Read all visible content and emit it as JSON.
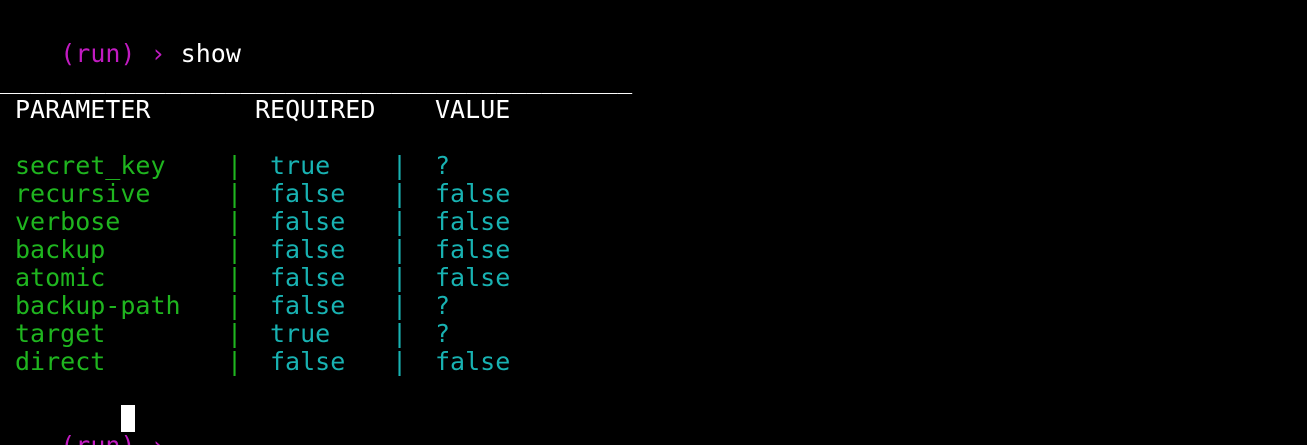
{
  "prompt": {
    "context": "(run)",
    "arrow": "›"
  },
  "command": "show",
  "separator": "__________________________________________",
  "table": {
    "headers": [
      "PARAMETER",
      "REQUIRED",
      "VALUE"
    ],
    "delimiter": "|",
    "rows": [
      {
        "parameter": "secret_key",
        "required": "true",
        "value": "?"
      },
      {
        "parameter": "recursive",
        "required": "false",
        "value": "false"
      },
      {
        "parameter": "verbose",
        "required": "false",
        "value": "false"
      },
      {
        "parameter": "backup",
        "required": "false",
        "value": "false"
      },
      {
        "parameter": "atomic",
        "required": "false",
        "value": "false"
      },
      {
        "parameter": "backup-path",
        "required": "false",
        "value": "?"
      },
      {
        "parameter": "target",
        "required": "true",
        "value": "?"
      },
      {
        "parameter": "direct",
        "required": "false",
        "value": "false"
      }
    ]
  },
  "colors": {
    "background": "#000000",
    "prompt": "#c21bc2",
    "parameter": "#1fb51f",
    "value": "#18b2b2",
    "text": "#ffffff"
  }
}
